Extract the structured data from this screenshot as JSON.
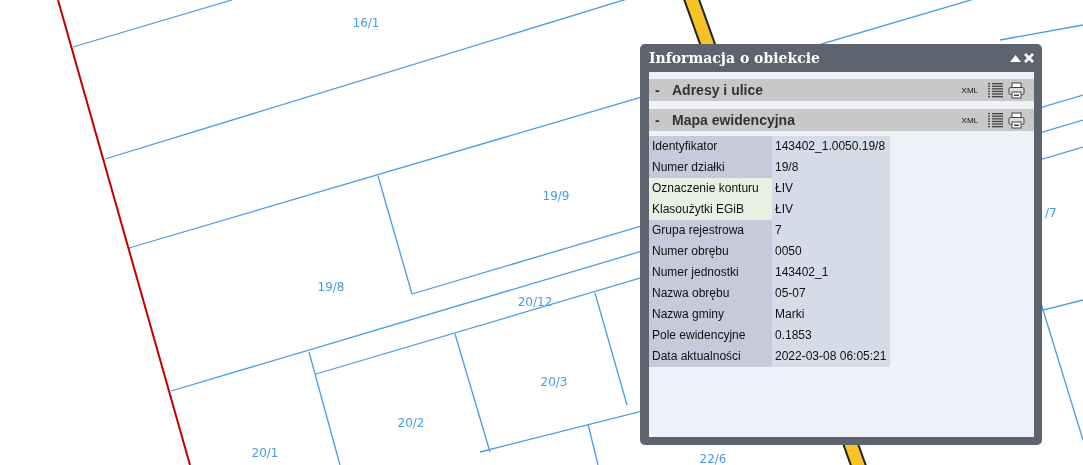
{
  "map": {
    "parcel_labels": [
      "16/1",
      "19/9",
      "19/8",
      "20/12",
      "20/3",
      "20/2",
      "20/1",
      "22/6",
      "/7"
    ]
  },
  "panel": {
    "title": "Informacja o obiekcie",
    "sections": [
      {
        "toggle": "-",
        "title": "Adresy i ulice",
        "xml": "XML"
      },
      {
        "toggle": "-",
        "title": "Mapa ewidencyjna",
        "xml": "XML",
        "rows": [
          {
            "label": "Identyfikator",
            "value": "143402_1.0050.19/8",
            "highlighted": false
          },
          {
            "label": "Numer działki",
            "value": "19/8",
            "highlighted": false
          },
          {
            "label": "Oznaczenie konturu",
            "value": "ŁIV",
            "highlighted": true
          },
          {
            "label": "Klasoużytki EGiB",
            "value": "ŁIV",
            "highlighted": true
          },
          {
            "label": "Grupa rejestrowa",
            "value": "7",
            "highlighted": false
          },
          {
            "label": "Numer obrębu",
            "value": "0050",
            "highlighted": false
          },
          {
            "label": "Numer jednostki",
            "value": "143402_1",
            "highlighted": false
          },
          {
            "label": "Nazwa obrębu",
            "value": "05-07",
            "highlighted": false
          },
          {
            "label": "Nazwa gminy",
            "value": "Marki",
            "highlighted": false
          },
          {
            "label": "Pole ewidencyjne",
            "value": "0.1853",
            "highlighted": false
          },
          {
            "label": "Data aktualności",
            "value": "2022-03-08 06:05:21",
            "highlighted": false
          }
        ]
      }
    ]
  }
}
